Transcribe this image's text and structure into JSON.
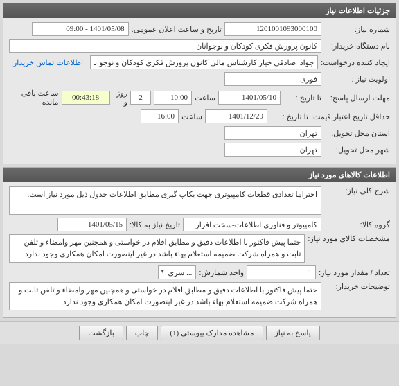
{
  "panel1": {
    "title": "جزئیات اطلاعات نیاز",
    "need_no_label": "شماره نیاز:",
    "need_no": "1201001093000100",
    "pub_time_label": "تاریخ و ساعت اعلان عمومی:",
    "pub_time": "1401/05/08 - 09:00",
    "buyer_label": "نام دستگاه خریدار:",
    "buyer": "کانون پرورش فکری کودکان و نوجوانان",
    "creator_label": "ایجاد کننده درخواست:",
    "creator": "جواد  صادقی خیار کارشناس مالی کانون پرورش فکری کودکان و نوجوانان",
    "contact_link": "اطلاعات تماس خریدار",
    "priority_label": "اولویت نیاز :",
    "priority": "فوری",
    "deadline_label": "مهلت ارسال پاسخ:",
    "to_label1": "تا تاریخ :",
    "deadline_date": "1401/05/10",
    "time_label": "ساعت",
    "deadline_time": "10:00",
    "days_remaining": "2",
    "days_txt": "روز و",
    "countdown": "00:43:18",
    "remain_txt": "ساعت باقی مانده",
    "validity_label": "حداقل تاریخ اعتبار قیمت:",
    "to_label2": "تا تاریخ :",
    "validity_date": "1401/12/29",
    "validity_time": "16:00",
    "province_label": "استان محل تحویل:",
    "province": "تهران",
    "city_label": "شهر محل تحویل:",
    "city": "تهران"
  },
  "panel2": {
    "title": "اطلاعات کالاهای مورد نیاز",
    "desc_label": "شرح کلی نیاز:",
    "desc": "احتراما تعدادی قطعات کامپیوتری جهت بکاپ گیری مطابق اطلاعات جدول ذیل مورد نیاز است.",
    "group_label": "گروه کالا:",
    "group": "کامپیوتر و فناوری اطلاعات-سخت افزار",
    "need_date_label": "تاریخ نیاز به کالا:",
    "need_date": "1401/05/15",
    "spec_label": "مشخصات کالای مورد نیاز:",
    "spec": "حتما پیش فاکتور با اطلاعات دقیق و مطابق اقلام در خواستی و همچنین مهر وامضاء و تلفن ثابت و همراه شرکت ضمیمه استعلام بهاء باشد در غیر اینصورت امکان همکاری وجود ندارد.",
    "qty_label": "تعداد / مقدار مورد نیاز:",
    "qty": "1",
    "unit_label": "واحد شمارش:",
    "unit": "... سری",
    "buyer_notes_label": "توضیحات خریدار:",
    "buyer_notes": "حتما پیش فاکتور با اطلاعات دقیق و مطابق اقلام در خواستی و همچنین مهر وامضاء و تلفن ثابت و همراه شرکت ضمیمه استعلام بهاء باشد در غیر اینصورت امکان همکاری وجود ندارد."
  },
  "buttons": {
    "reply": "پاسخ به نیاز",
    "attachments": "مشاهده مدارک پیوستی (1)",
    "print": "چاپ",
    "back": "بازگشت"
  }
}
